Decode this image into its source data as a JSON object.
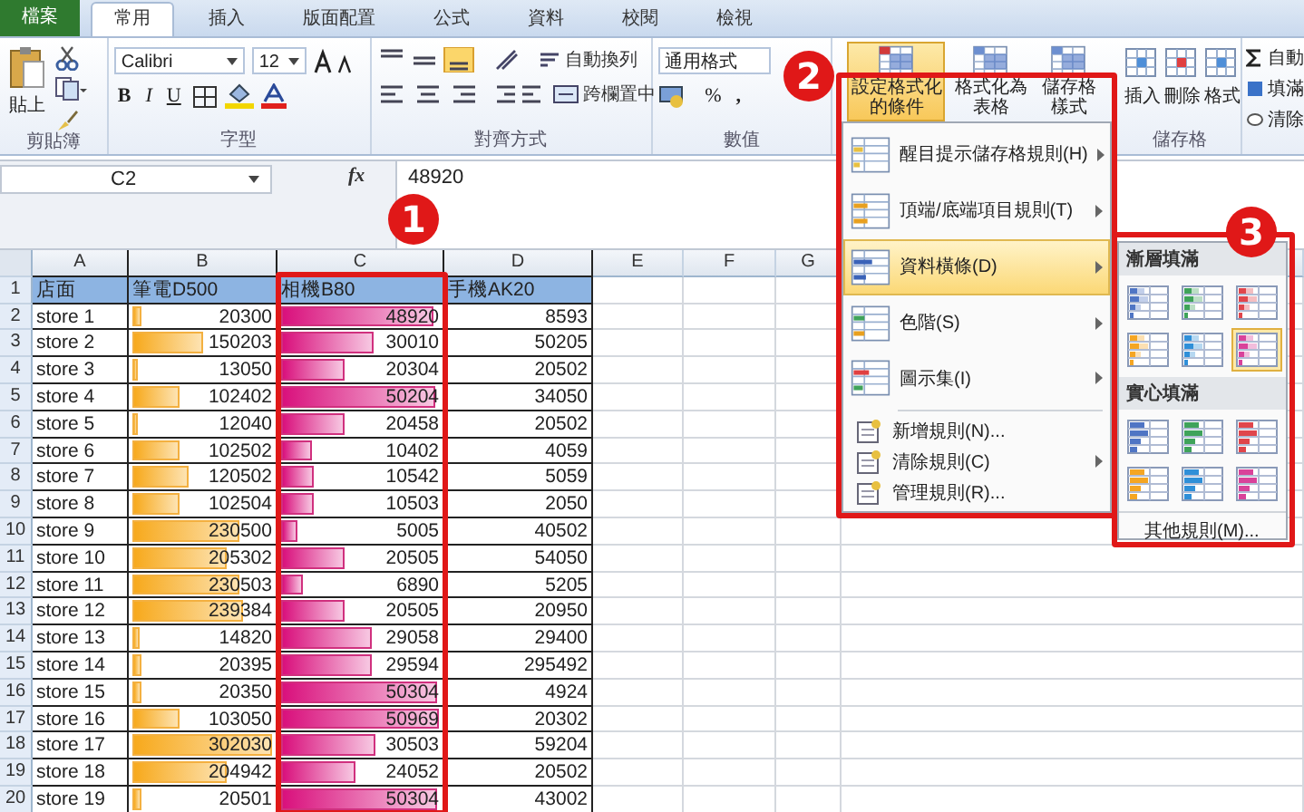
{
  "tabs": [
    {
      "label": "檔案",
      "kind": "file",
      "selected": false
    },
    {
      "label": "常用",
      "kind": "tab",
      "selected": true
    },
    {
      "label": "插入",
      "kind": "tab",
      "selected": false
    },
    {
      "label": "版面配置",
      "kind": "tab",
      "selected": false
    },
    {
      "label": "公式",
      "kind": "tab",
      "selected": false
    },
    {
      "label": "資料",
      "kind": "tab",
      "selected": false
    },
    {
      "label": "校閱",
      "kind": "tab",
      "selected": false
    },
    {
      "label": "檢視",
      "kind": "tab",
      "selected": false
    }
  ],
  "ribbon": {
    "clipboard": {
      "paste": "貼上",
      "label": "剪貼簿"
    },
    "font": {
      "name": "Calibri",
      "size": "12",
      "bold": "B",
      "italic": "I",
      "underline": "U",
      "label": "字型"
    },
    "alignment": {
      "wrap": "自動換列",
      "merge": "跨欄置中",
      "label": "對齊方式"
    },
    "number": {
      "format": "通用格式",
      "percent": "%",
      "comma": ",",
      "label": "數值"
    },
    "styles": [
      {
        "label": "設定格式化的條件",
        "selected": true
      },
      {
        "label": "格式化為表格",
        "selected": false
      },
      {
        "label": "儲存格樣式",
        "selected": false
      }
    ],
    "cells": {
      "buttons": [
        "插入",
        "刪除",
        "格式"
      ],
      "label": "儲存格"
    },
    "editing": [
      "自動",
      "填滿",
      "清除"
    ]
  },
  "formula_bar": {
    "name_box": "C2",
    "fx": "fx",
    "value": "48920"
  },
  "sheet": {
    "columns": [
      "A",
      "B",
      "C",
      "D",
      "E",
      "F",
      "G"
    ],
    "header_row": {
      "n": "1",
      "cells": [
        "店面",
        "筆電D500",
        "相機B80",
        "手機AK20"
      ]
    },
    "rows": [
      {
        "n": "2",
        "store": "store 1",
        "b": {
          "text": "20300",
          "level": 0.07
        },
        "c": {
          "text": "48920",
          "level": 0.96
        },
        "d": "8593"
      },
      {
        "n": "3",
        "store": "store 2",
        "b": {
          "text": "150203",
          "level": 0.5
        },
        "c": {
          "text": "30010",
          "level": 0.59
        },
        "d": "50205"
      },
      {
        "n": "4",
        "store": "store 3",
        "b": {
          "text": "13050",
          "level": 0.04
        },
        "c": {
          "text": "20304",
          "level": 0.4
        },
        "d": "20502"
      },
      {
        "n": "5",
        "store": "store 4",
        "b": {
          "text": "102402",
          "level": 0.34
        },
        "c": {
          "text": "50204",
          "level": 0.98
        },
        "d": "34050"
      },
      {
        "n": "6",
        "store": "store 5",
        "b": {
          "text": "12040",
          "level": 0.04
        },
        "c": {
          "text": "20458",
          "level": 0.4
        },
        "d": "20502"
      },
      {
        "n": "7",
        "store": "store 6",
        "b": {
          "text": "102502",
          "level": 0.34
        },
        "c": {
          "text": "10402",
          "level": 0.2
        },
        "d": "4059"
      },
      {
        "n": "8",
        "store": "store 7",
        "b": {
          "text": "120502",
          "level": 0.4
        },
        "c": {
          "text": "10542",
          "level": 0.21
        },
        "d": "5059"
      },
      {
        "n": "9",
        "store": "store 8",
        "b": {
          "text": "102504",
          "level": 0.34
        },
        "c": {
          "text": "10503",
          "level": 0.21
        },
        "d": "2050"
      },
      {
        "n": "10",
        "store": "store 9",
        "b": {
          "text": "230500",
          "level": 0.76
        },
        "c": {
          "text": "5005",
          "level": 0.1
        },
        "d": "40502"
      },
      {
        "n": "11",
        "store": "store 10",
        "b": {
          "text": "205302",
          "level": 0.68
        },
        "c": {
          "text": "20505",
          "level": 0.4
        },
        "d": "54050"
      },
      {
        "n": "12",
        "store": "store 11",
        "b": {
          "text": "230503",
          "level": 0.76
        },
        "c": {
          "text": "6890",
          "level": 0.14
        },
        "d": "5205"
      },
      {
        "n": "13",
        "store": "store 12",
        "b": {
          "text": "239384",
          "level": 0.79
        },
        "c": {
          "text": "20505",
          "level": 0.4
        },
        "d": "20950"
      },
      {
        "n": "14",
        "store": "store 13",
        "b": {
          "text": "14820",
          "level": 0.05
        },
        "c": {
          "text": "29058",
          "level": 0.57
        },
        "d": "29400"
      },
      {
        "n": "15",
        "store": "store 14",
        "b": {
          "text": "20395",
          "level": 0.07
        },
        "c": {
          "text": "29594",
          "level": 0.58
        },
        "d": "295492"
      },
      {
        "n": "16",
        "store": "store 15",
        "b": {
          "text": "20350",
          "level": 0.07
        },
        "c": {
          "text": "50304",
          "level": 0.99
        },
        "d": "4924"
      },
      {
        "n": "17",
        "store": "store 16",
        "b": {
          "text": "103050",
          "level": 0.34
        },
        "c": {
          "text": "50969",
          "level": 1.0
        },
        "d": "20302"
      },
      {
        "n": "18",
        "store": "store 17",
        "b": {
          "text": "302030",
          "level": 1.0
        },
        "c": {
          "text": "30503",
          "level": 0.6
        },
        "d": "59204"
      },
      {
        "n": "19",
        "store": "store 18",
        "b": {
          "text": "204942",
          "level": 0.68
        },
        "c": {
          "text": "24052",
          "level": 0.47
        },
        "d": "20502"
      },
      {
        "n": "20",
        "store": "store 19",
        "b": {
          "text": "20501",
          "level": 0.07
        },
        "c": {
          "text": "50304",
          "level": 0.99
        },
        "d": "43002"
      }
    ]
  },
  "menu": {
    "items": [
      {
        "label": "醒目提示儲存格規則(H)",
        "kind": "large",
        "submenu": true,
        "selected": false
      },
      {
        "label": "頂端/底端項目規則(T)",
        "kind": "large",
        "submenu": true,
        "selected": false
      },
      {
        "label": "資料橫條(D)",
        "kind": "large",
        "submenu": true,
        "selected": true
      },
      {
        "label": "色階(S)",
        "kind": "large",
        "submenu": true,
        "selected": false
      },
      {
        "label": "圖示集(I)",
        "kind": "large",
        "submenu": true,
        "selected": false
      },
      {
        "label": "新增規則(N)...",
        "kind": "small",
        "submenu": false,
        "selected": false
      },
      {
        "label": "清除規則(C)",
        "kind": "small",
        "submenu": true,
        "selected": false
      },
      {
        "label": "管理規則(R)...",
        "kind": "small",
        "submenu": false,
        "selected": false
      }
    ]
  },
  "gallery": {
    "sections": [
      {
        "title": "漸層填滿",
        "kind": "gradient",
        "options": [
          {
            "color": "#4f75c4",
            "selected": false
          },
          {
            "color": "#3fa35a",
            "selected": false
          },
          {
            "color": "#e0464c",
            "selected": false
          },
          {
            "color": "#f5a623",
            "selected": false
          },
          {
            "color": "#2f8fd8",
            "selected": false
          },
          {
            "color": "#d9429a",
            "selected": true
          }
        ]
      },
      {
        "title": "實心填滿",
        "kind": "solid",
        "options": [
          {
            "color": "#4f75c4",
            "selected": false
          },
          {
            "color": "#3fa35a",
            "selected": false
          },
          {
            "color": "#e0464c",
            "selected": false
          },
          {
            "color": "#f5a623",
            "selected": false
          },
          {
            "color": "#2f8fd8",
            "selected": false
          },
          {
            "color": "#d9429a",
            "selected": false
          }
        ]
      }
    ],
    "more": "其他規則(M)..."
  },
  "callouts": [
    "1",
    "2",
    "3"
  ]
}
